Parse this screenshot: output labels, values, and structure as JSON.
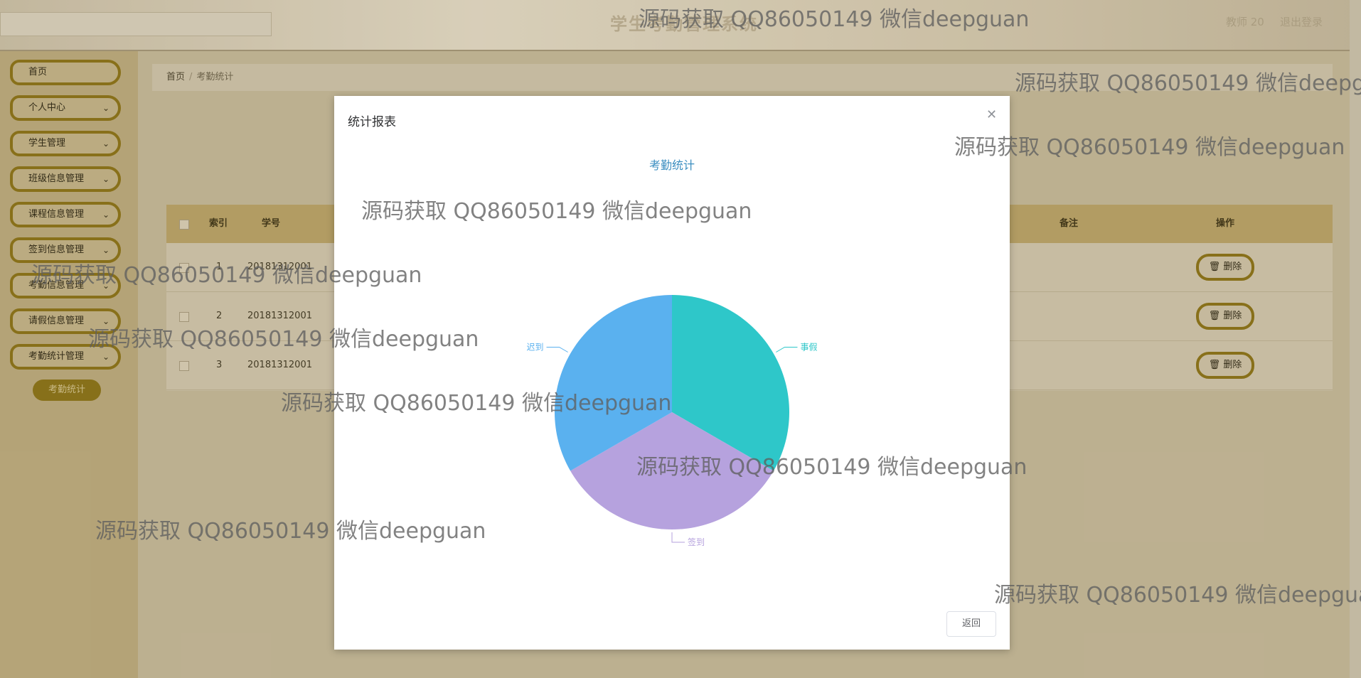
{
  "header": {
    "title": "学生考勤管理系统",
    "user": "教师 20",
    "logout": "退出登录"
  },
  "sidebar": {
    "items": [
      {
        "label": "首页",
        "has_chevron": false
      },
      {
        "label": "个人中心",
        "has_chevron": true
      },
      {
        "label": "学生管理",
        "has_chevron": true
      },
      {
        "label": "班级信息管理",
        "has_chevron": true
      },
      {
        "label": "课程信息管理",
        "has_chevron": true
      },
      {
        "label": "签到信息管理",
        "has_chevron": true
      },
      {
        "label": "考勤信息管理",
        "has_chevron": true
      },
      {
        "label": "请假信息管理",
        "has_chevron": true
      },
      {
        "label": "考勤统计管理",
        "has_chevron": true
      }
    ],
    "sub_item": "考勤统计"
  },
  "breadcrumb": {
    "home": "首页",
    "current": "考勤统计"
  },
  "table": {
    "headers": {
      "index": "索引",
      "student_no": "学号",
      "remark": "备注",
      "actions": "操作"
    },
    "rows": [
      {
        "index": "1",
        "student_no": "20181312001"
      },
      {
        "index": "2",
        "student_no": "20181312001"
      },
      {
        "index": "3",
        "student_no": "20181312001"
      }
    ],
    "delete_label": "删除"
  },
  "modal": {
    "title": "统计报表",
    "close_icon": "close-icon",
    "back_label": "返回"
  },
  "chart_data": {
    "type": "pie",
    "title": "考勤统计",
    "slices": [
      {
        "label": "事假",
        "value": 1,
        "color": "#2ec7c9"
      },
      {
        "label": "签到",
        "value": 1,
        "color": "#b6a2de"
      },
      {
        "label": "迟到",
        "value": 1,
        "color": "#5ab1ef"
      }
    ]
  },
  "watermark": "源码获取 QQ86050149 微信deepguan"
}
